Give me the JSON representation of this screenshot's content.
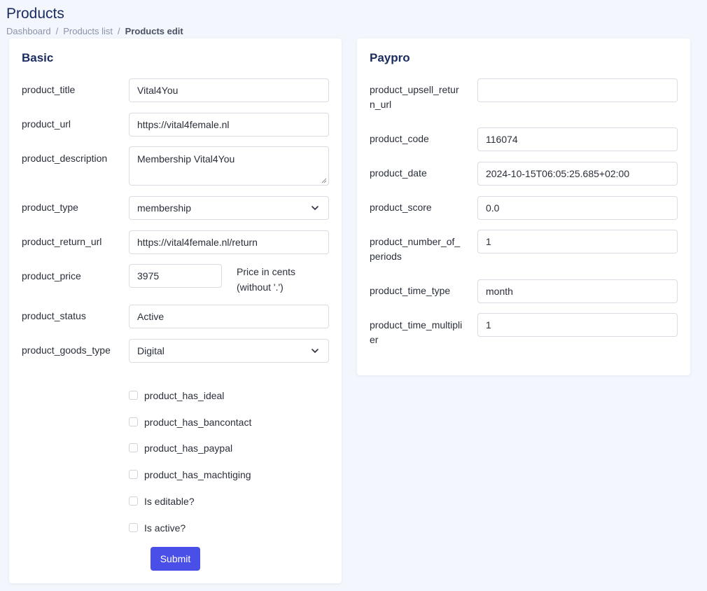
{
  "page": {
    "title": "Products",
    "breadcrumb": [
      "Dashboard",
      "Products list",
      "Products edit"
    ]
  },
  "basic": {
    "title": "Basic",
    "fields": {
      "product_title": {
        "label": "product_title",
        "value": "Vital4You"
      },
      "product_url": {
        "label": "product_url",
        "value": "https://vital4female.nl"
      },
      "product_description": {
        "label": "product_description",
        "value": "Membership Vital4You"
      },
      "product_type": {
        "label": "product_type",
        "value": "membership"
      },
      "product_return_url": {
        "label": "product_return_url",
        "value": "https://vital4female.nl/return"
      },
      "product_price": {
        "label": "product_price",
        "value": "3975",
        "hint": "Price in cents (without '.')"
      },
      "product_status": {
        "label": "product_status",
        "value": "Active"
      },
      "product_goods_type": {
        "label": "product_goods_type",
        "value": "Digital"
      }
    },
    "checkboxes": [
      {
        "label": "product_has_ideal",
        "checked": false
      },
      {
        "label": "product_has_bancontact",
        "checked": false
      },
      {
        "label": "product_has_paypal",
        "checked": false
      },
      {
        "label": "product_has_machtiging",
        "checked": false
      },
      {
        "label": "Is editable?",
        "checked": false
      },
      {
        "label": "Is active?",
        "checked": false
      }
    ],
    "submit_label": "Submit"
  },
  "paypro": {
    "title": "Paypro",
    "fields": {
      "product_upsell_return_url": {
        "label": "product_upsell_return_url",
        "value": ""
      },
      "product_code": {
        "label": "product_code",
        "value": "116074"
      },
      "product_date": {
        "label": "product_date",
        "value": "2024-10-15T06:05:25.685+02:00"
      },
      "product_score": {
        "label": "product_score",
        "value": "0.0"
      },
      "product_number_of_periods": {
        "label": "product_number_of_periods",
        "value": "1"
      },
      "product_time_type": {
        "label": "product_time_type",
        "value": "month"
      },
      "product_time_multiplier": {
        "label": "product_time_multiplier",
        "value": "1"
      }
    }
  },
  "colors": {
    "accent": "#4a4fe8",
    "heading": "#1a2b5f",
    "background": "#f3f6fd"
  }
}
